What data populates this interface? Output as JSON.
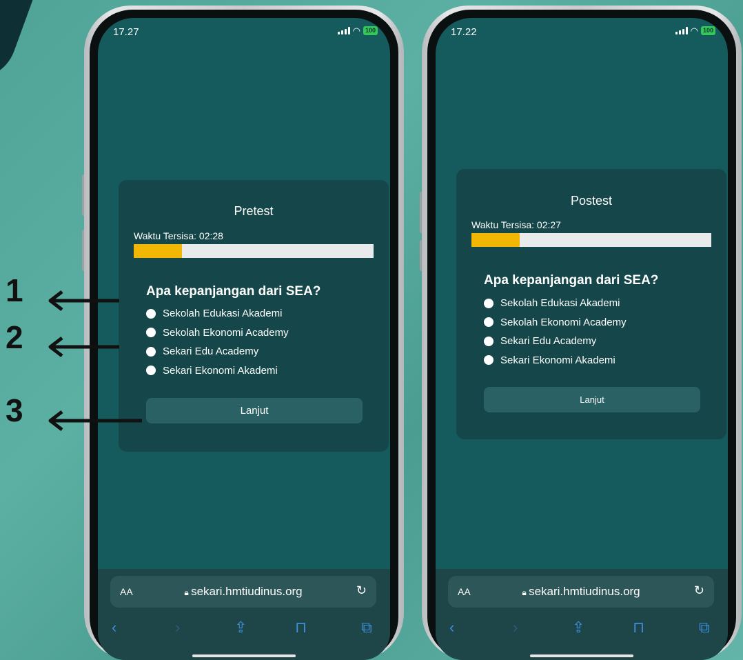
{
  "left_phone": {
    "status_time": "17.27",
    "battery": "100",
    "card_title": "Pretest",
    "timer_label": "Waktu Tersisa: 02:28",
    "progress": 0.2,
    "question": "Apa kepanjangan dari SEA?",
    "options": [
      "Sekolah Edukasi Akademi",
      "Sekolah Ekonomi Academy",
      "Sekari Edu Academy",
      "Sekari Ekonomi Akademi"
    ],
    "next_label": "Lanjut",
    "url_aa": "AA",
    "url": "sekari.hmtiudinus.org"
  },
  "right_phone": {
    "status_time": "17.22",
    "battery": "100",
    "card_title": "Postest",
    "timer_label": "Waktu Tersisa: 02:27",
    "progress": 0.2,
    "question": "Apa kepanjangan dari SEA?",
    "options": [
      "Sekolah Edukasi Akademi",
      "Sekolah Ekonomi Academy",
      "Sekari Edu Academy",
      "Sekari Ekonomi Akademi"
    ],
    "next_label": "Lanjut",
    "url_aa": "AA",
    "url": "sekari.hmtiudinus.org"
  },
  "annotations": [
    "1",
    "2",
    "3"
  ],
  "icons": {
    "lock": "lock-icon",
    "reload": "reload-icon",
    "back": "back-icon",
    "forward": "forward-icon",
    "share": "share-icon",
    "bookmarks": "bookmarks-icon",
    "tabs": "tabs-icon"
  },
  "colors": {
    "screen_bg": "#155a5c",
    "card_bg": "#15474a",
    "progress_fill": "#f2b704",
    "progress_track": "#e8eaec",
    "toolbar_icon": "#3f8ed8"
  }
}
